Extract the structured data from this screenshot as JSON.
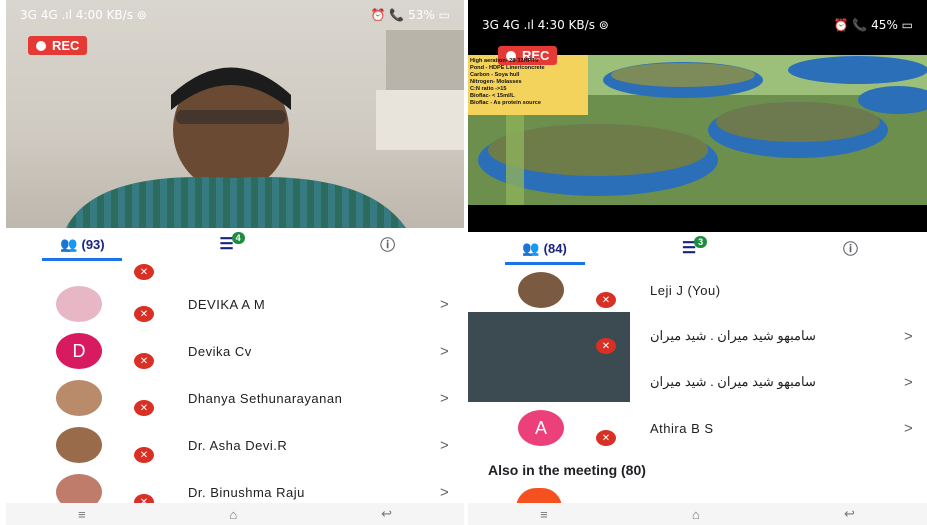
{
  "left": {
    "status": {
      "left": "3G 4G .ıl 4:00 KB/s ⊚",
      "right": "⏰ 📞 53% ▭"
    },
    "rec_label": "REC",
    "tabs": {
      "people_count": "(93)",
      "chat_badge": "4"
    },
    "participants": [
      {
        "name": "DEVIKA A M",
        "avatar": "photo",
        "color": "#e7b7c6"
      },
      {
        "name": "Devika Cv",
        "avatar": "D",
        "color": "#d81b60"
      },
      {
        "name": "Dhanya Sethunarayanan",
        "avatar": "photo",
        "color": "#b98b6a"
      },
      {
        "name": "Dr. Asha Devi.R",
        "avatar": "photo",
        "color": "#9a6b4b"
      },
      {
        "name": "Dr. Binushma Raju",
        "avatar": "photo",
        "color": "#c07c6a"
      }
    ]
  },
  "right": {
    "status": {
      "left": "3G 4G .ıl 4:30 KB/s ⊚",
      "right": "⏰ 📞 45% ▭"
    },
    "rec_label": "REC",
    "overlay_text": [
      "High aeration- 28-32HP/Hr",
      "Pond - HDPE Liner/concrete",
      "Carbon - Soya hull",
      "Nitrogen- Molasses",
      "C:N ratio ->15",
      "Bioflac- < 15ml/L",
      "Bioflac - As protein source"
    ],
    "tabs": {
      "people_count": "(84)",
      "chat_badge": "3"
    },
    "participants": [
      {
        "name": "Leji J (You)",
        "avatar": "photo",
        "color": "#7a5a40",
        "chevron": false
      },
      {
        "name": "سامبهو شيد ميران . شيد ميران",
        "avatar": "video",
        "color": "#556b7a",
        "chevron": true
      },
      {
        "name": "سامبهو شيد ميران . شيد ميران",
        "avatar": "none",
        "color": "#ffffff",
        "chevron": true
      },
      {
        "name": "Athira B S",
        "avatar": "A",
        "color": "#ec407a",
        "chevron": true
      }
    ],
    "also_label": "Also in the meeting (80)"
  },
  "icons": {
    "people": "people-icon",
    "chat": "chat-icon",
    "info": "info-icon",
    "mic_off": "mic-off-icon",
    "chevron": "chevron-right-icon"
  }
}
